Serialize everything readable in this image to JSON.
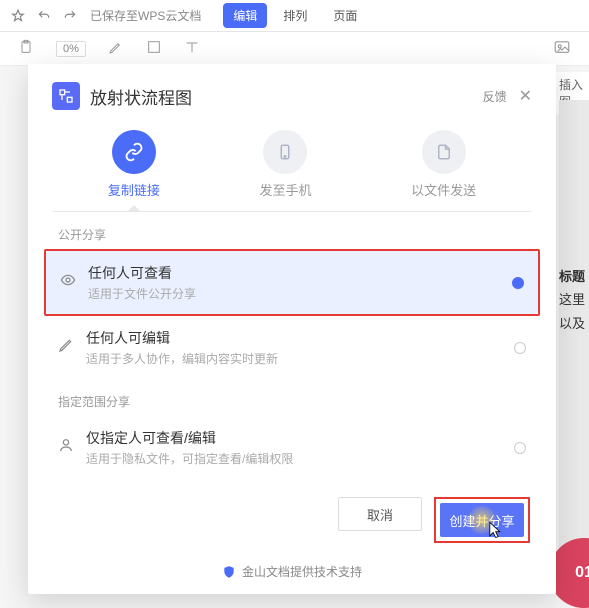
{
  "toolbar": {
    "saved_text": "已保存至WPS云文档",
    "tabs": {
      "edit": "编辑",
      "arrange": "排列",
      "page": "页面"
    },
    "zoom": "0%"
  },
  "side": {
    "insert_image": "插入图",
    "heading": "标题",
    "desc1": "这里",
    "desc2": "以及"
  },
  "modal": {
    "title": "放射状流程图",
    "feedback": "反馈",
    "tabs": {
      "copy_link": "复制链接",
      "send_phone": "发至手机",
      "send_file": "以文件发送"
    },
    "section_public": "公开分享",
    "section_scope": "指定范围分享",
    "options": {
      "view": {
        "title": "任何人可查看",
        "desc": "适用于文件公开分享"
      },
      "edit": {
        "title": "任何人可编辑",
        "desc": "适用于多人协作，编辑内容实时更新"
      },
      "scoped": {
        "title": "仅指定人可查看/编辑",
        "desc": "适用于隐私文件，可指定查看/编辑权限"
      }
    },
    "buttons": {
      "cancel": "取消",
      "create": "创建并分享"
    },
    "footer": "金山文档提供技术支持"
  },
  "badge": "01"
}
